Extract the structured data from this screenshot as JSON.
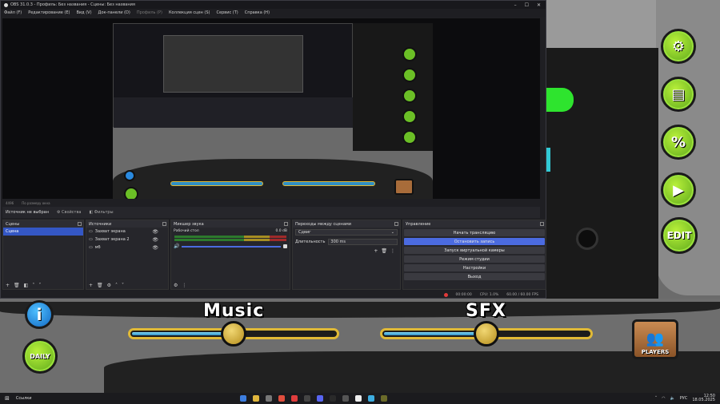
{
  "obs": {
    "title": "OBS 31.0.3 - Профиль: Без названия - Сцены: Без названия",
    "menu": [
      {
        "label": "Файл (F)",
        "enabled": true
      },
      {
        "label": "Редактирование (E)",
        "enabled": true
      },
      {
        "label": "Вид (V)",
        "enabled": true
      },
      {
        "label": "Док-панели (D)",
        "enabled": true
      },
      {
        "label": "Профиль (P)",
        "enabled": false
      },
      {
        "label": "Коллекция сцен (S)",
        "enabled": true
      },
      {
        "label": "Сервис (T)",
        "enabled": true
      },
      {
        "label": "Справка (H)",
        "enabled": true
      }
    ],
    "status_row": {
      "left": "4496",
      "right": "По размеру окна"
    },
    "source_bar": {
      "status": "Источник не выбран",
      "properties": "Свойства",
      "filters": "Фильтры"
    },
    "scenes": {
      "title": "Сцены",
      "items": [
        "Сцена"
      ]
    },
    "sources": {
      "title": "Источники",
      "items": [
        "Захват экрана",
        "Захват экрана 2",
        "мб"
      ]
    },
    "mixer": {
      "title": "Микшер звука",
      "channel": "Рабочий стол",
      "db": "0.0 dB"
    },
    "transitions": {
      "title": "Переходы между сценами",
      "type": "Сдвиг",
      "duration_label": "Длительность",
      "duration_value": "300 ms"
    },
    "controls": {
      "title": "Управление",
      "buttons": [
        {
          "label": "Начать трансляцию",
          "active": false
        },
        {
          "label": "Остановить запись",
          "active": true
        },
        {
          "label": "Запуск виртуальной камеры",
          "active": false
        },
        {
          "label": "Режим студии",
          "active": false
        },
        {
          "label": "Настройки",
          "active": false
        },
        {
          "label": "Выход",
          "active": false
        }
      ]
    },
    "status_bar": {
      "rec_time": "00:00:00",
      "cpu": "CPU: 1.0%",
      "fps": "60.00 / 60.00 FPS"
    }
  },
  "game": {
    "music_label": "Music",
    "sfx_label": "SFX",
    "music_level": 0.5,
    "sfx_level": 0.5,
    "players_label": "PLAYERS",
    "daily_label": "DAILY",
    "edit_label": "EDIT",
    "percent_label": "%",
    "info_label": "i",
    "colors": {
      "green": "#5ca81b",
      "slider": "#2f8fc4",
      "gold": "#e0b936"
    }
  },
  "taskbar": {
    "search_label": "Ссылки",
    "lang": "РУС",
    "time": "12:50",
    "date": "18.05.2025"
  }
}
